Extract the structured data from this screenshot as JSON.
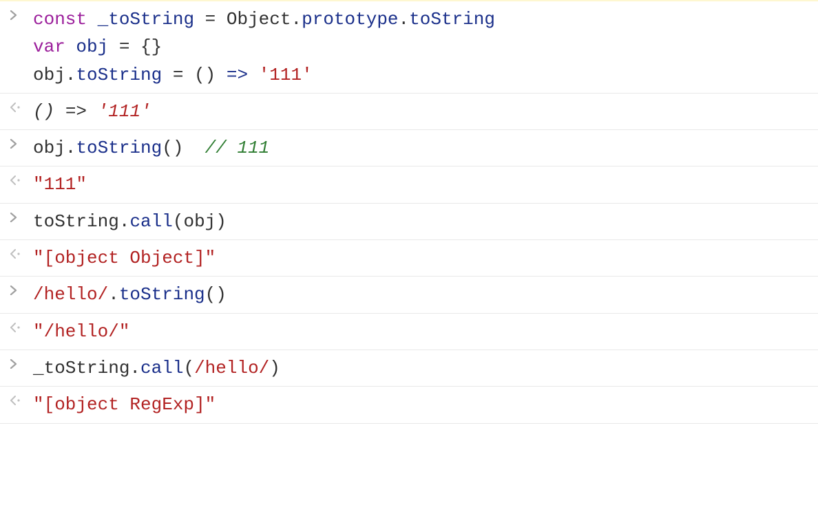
{
  "rows": [
    {
      "type": "input",
      "highlight": true,
      "tokens": [
        {
          "t": "const",
          "cls": "kw"
        },
        {
          "t": " "
        },
        {
          "t": "_toString",
          "cls": "var"
        },
        {
          "t": " = "
        },
        {
          "t": "Object",
          "cls": ""
        },
        {
          "t": "."
        },
        {
          "t": "prototype",
          "cls": "var"
        },
        {
          "t": "."
        },
        {
          "t": "toString",
          "cls": "var"
        },
        {
          "t": "\n"
        },
        {
          "t": "var",
          "cls": "kw"
        },
        {
          "t": " "
        },
        {
          "t": "obj",
          "cls": "var"
        },
        {
          "t": " = {}"
        },
        {
          "t": "\n"
        },
        {
          "t": "obj."
        },
        {
          "t": "toString",
          "cls": "var"
        },
        {
          "t": " = () "
        },
        {
          "t": "=>",
          "cls": "arrow"
        },
        {
          "t": " "
        },
        {
          "t": "'111'",
          "cls": "str"
        }
      ]
    },
    {
      "type": "output",
      "tokens": [
        {
          "t": "() ",
          "cls": "output-italic"
        },
        {
          "t": "=>",
          "cls": "output-italic"
        },
        {
          "t": " ",
          "cls": "output-italic"
        },
        {
          "t": "'111'",
          "cls": "output-red-italic"
        }
      ]
    },
    {
      "type": "input",
      "tokens": [
        {
          "t": "obj."
        },
        {
          "t": "toString",
          "cls": "var"
        },
        {
          "t": "()  "
        },
        {
          "t": "// 111",
          "cls": "comment"
        }
      ]
    },
    {
      "type": "output",
      "tokens": [
        {
          "t": "\"111\"",
          "cls": "output-red"
        }
      ]
    },
    {
      "type": "input",
      "tokens": [
        {
          "t": "toString."
        },
        {
          "t": "call",
          "cls": "var"
        },
        {
          "t": "(obj)"
        }
      ]
    },
    {
      "type": "output",
      "tokens": [
        {
          "t": "\"[object Object]\"",
          "cls": "output-red"
        }
      ]
    },
    {
      "type": "input",
      "tokens": [
        {
          "t": "/hello/",
          "cls": "regex"
        },
        {
          "t": "."
        },
        {
          "t": "toString",
          "cls": "var"
        },
        {
          "t": "()"
        }
      ]
    },
    {
      "type": "output",
      "tokens": [
        {
          "t": "\"/hello/\"",
          "cls": "output-red"
        }
      ]
    },
    {
      "type": "input",
      "tokens": [
        {
          "t": "_toString."
        },
        {
          "t": "call",
          "cls": "var"
        },
        {
          "t": "("
        },
        {
          "t": "/hello/",
          "cls": "regex"
        },
        {
          "t": ")"
        }
      ]
    },
    {
      "type": "output",
      "tokens": [
        {
          "t": "\"[object RegExp]\"",
          "cls": "output-red"
        }
      ]
    }
  ]
}
